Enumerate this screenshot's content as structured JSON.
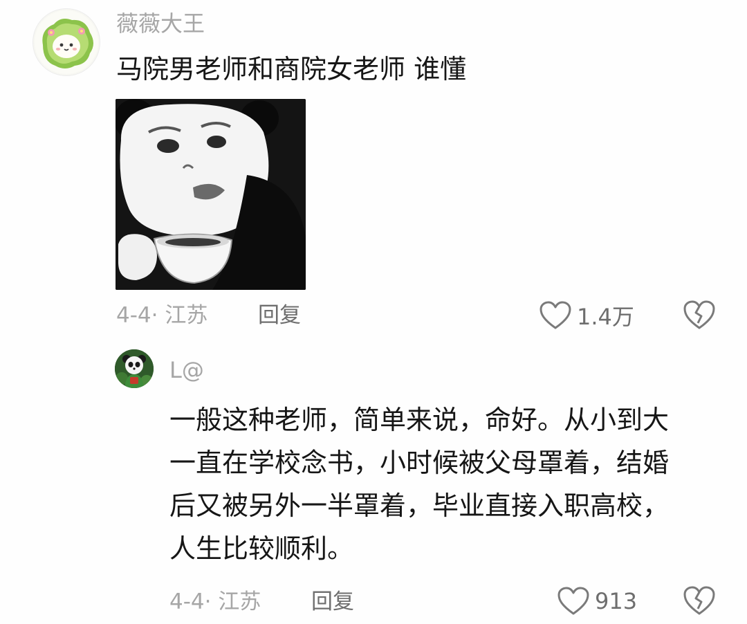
{
  "comments": [
    {
      "username": "薇薇大王",
      "text": "马院男老师和商院女老师 谁懂",
      "date_location": "4-4· 江苏",
      "reply_label": "回复",
      "like_count": "1.4万",
      "avatar_icon": "cabbage-character-avatar",
      "sticker_icon": "panda-meme-teacup-sticker"
    },
    {
      "username": "L@",
      "text_lines": [
        "一般这种老师，简单来说，命好。从小到大",
        "一直在学校念书，小时候被父母罩着，结婚",
        "后又被另外一半罩着，毕业直接入职高校，",
        "人生比较顺利。"
      ],
      "date_location": "4-4· 江苏",
      "reply_label": "回复",
      "like_count": "913",
      "avatar_icon": "panda-character-avatar"
    }
  ],
  "colors": {
    "text_primary": "#161616",
    "text_secondary": "#a6a6a6",
    "action_gray": "#6e6e6e",
    "background": "#fefefe"
  }
}
